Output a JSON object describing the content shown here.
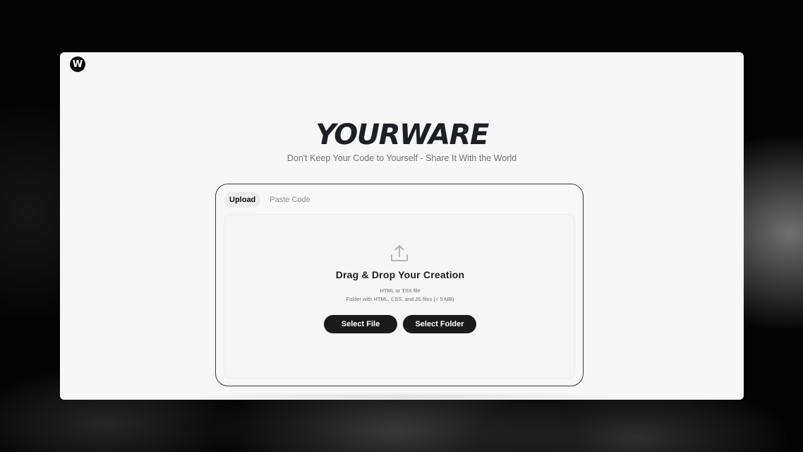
{
  "app": {
    "logo_letter": "W",
    "brand": "YOURWARE",
    "tagline": "Don't Keep Your Code to Yourself - Share It With the World"
  },
  "tabs": [
    {
      "label": "Upload",
      "active": true
    },
    {
      "label": "Paste Code",
      "active": false
    }
  ],
  "dropzone": {
    "icon": "upload-icon",
    "title": "Drag & Drop Your Creation",
    "line1": "HTML or TSX file",
    "line2": "Folder with HTML, CSS, and JS files (< 5 MB)"
  },
  "buttons": {
    "select_file": "Select File",
    "select_folder": "Select Folder"
  },
  "colors": {
    "button_bg": "#1a1a1a",
    "brand_text": "#1c1f26",
    "panel_border": "#3a3a3a"
  }
}
